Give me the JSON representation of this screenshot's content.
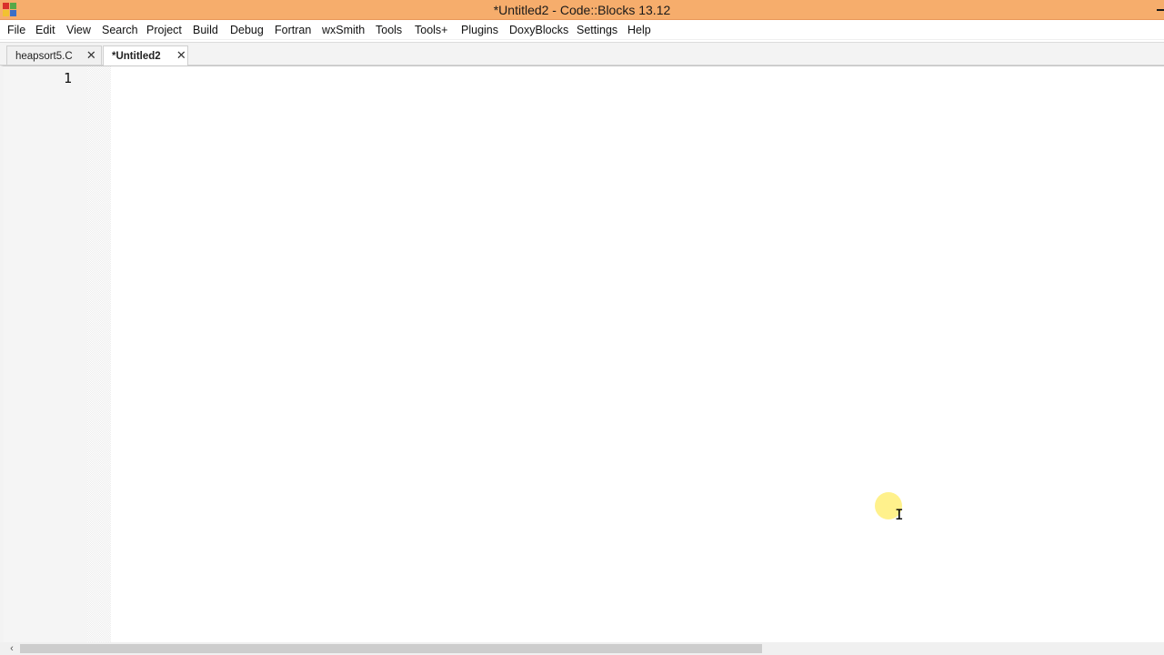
{
  "window": {
    "title": "*Untitled2 - Code::Blocks 13.12"
  },
  "menubar": {
    "items": [
      "File",
      "Edit",
      "View",
      "Search",
      "Project",
      "Build",
      "Debug",
      "Fortran",
      "wxSmith",
      "Tools",
      "Tools+",
      "Plugins",
      "DoxyBlocks",
      "Settings",
      "Help"
    ]
  },
  "tabs": [
    {
      "label": "heapsort5.C",
      "active": false,
      "close": "✕"
    },
    {
      "label": "*Untitled2",
      "active": true,
      "close": "✕"
    }
  ],
  "editor": {
    "line_numbers": [
      "1"
    ],
    "content": ""
  },
  "scrollbar": {
    "left_arrow": "‹"
  },
  "colors": {
    "titlebar": "#f6ad6c",
    "cursor_highlight": "#ffee78"
  },
  "icons": {
    "app": "codeblocks-app-icon",
    "minimize": "minimize-icon",
    "tab_close": "close-icon",
    "cursor": "text-cursor-ibeam-icon"
  }
}
